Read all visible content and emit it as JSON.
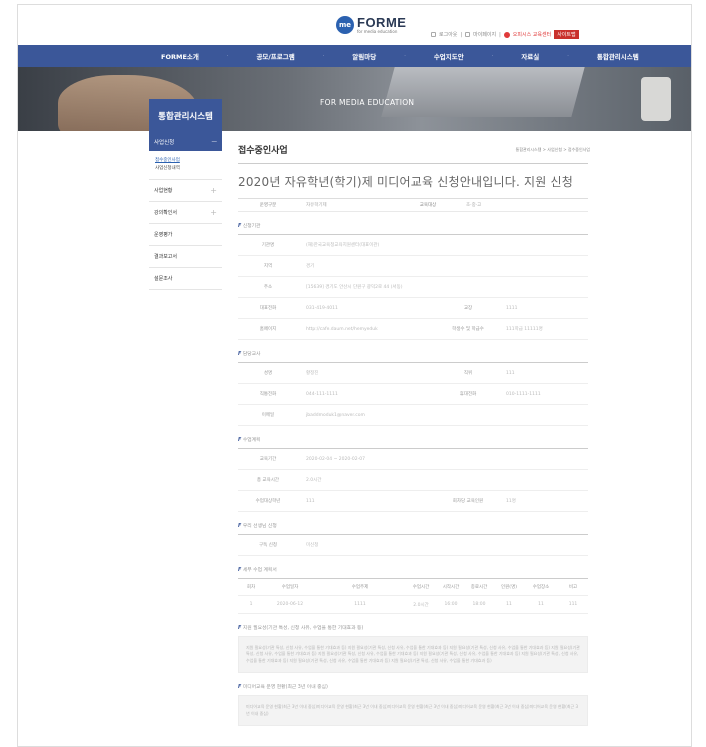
{
  "header": {
    "logo_mark": "me",
    "logo_title": "FORME",
    "logo_sub": "for media education",
    "util": [
      "로그아웃",
      "마이페이지",
      "오피시스 교육센터",
      "사이트맵"
    ],
    "util_badge": "사이트맵"
  },
  "nav": [
    "FORME소개",
    "공모/프로그램",
    "알림마당",
    "수업지도안",
    "자료실",
    "통합관리시스템"
  ],
  "banner": {
    "text": "FOR MEDIA EDUCATION"
  },
  "sidebar": {
    "title": "통합관리시스템",
    "active": "사업신청",
    "active_toggle": "—",
    "sub": [
      "접수중인사업",
      "사업신청내역"
    ],
    "items": [
      {
        "label": "사업현황",
        "plus": "+"
      },
      {
        "label": "강의확인서",
        "plus": "+"
      },
      {
        "label": "운영평가",
        "plus": ""
      },
      {
        "label": "결과보고서",
        "plus": ""
      },
      {
        "label": "설문조사",
        "plus": ""
      }
    ]
  },
  "content": {
    "page_title": "접수중인사업",
    "breadcrumb": "통합관리시스템 > 사업신청 > 접수중인사업",
    "headline": "2020년 자유학년(학기)제 미디어교육 신청안내입니다. 지원 신청",
    "summary": {
      "k1": "운영구분",
      "v1": "자유학기제",
      "k2": "교육대상",
      "v2": "초·중·고"
    },
    "sections": {
      "applicant": "신청기관",
      "manager": "담당교사",
      "plan": "수업계획",
      "request": "우리 선생님 신청",
      "schedule": "세부 수업 계획서",
      "reason": "지원 필요성(기관 특성, 신청 사유, 수업을 통한 기대효과 등)",
      "history": "미디어교육 운영 현황(최근 3년 이내 중심)"
    },
    "applicant": [
      {
        "k": "기관명",
        "v": "(재)한국교육청교육지원센터(대표이관)"
      },
      {
        "k": "지역",
        "v": "경기"
      },
      {
        "k": "주소",
        "v": "[15639] 경기도 안산시 단원구 광덕2로 44 (서동)"
      },
      {
        "k": "대표전화",
        "v": "031-419-4011",
        "k2": "교장",
        "v2": "1111"
      },
      {
        "k": "홈페이지",
        "v": "http://cafe.daum.net/hemyeduk",
        "k2": "학생수 및 학급수",
        "v2": "111학급 11111명"
      }
    ],
    "manager": [
      {
        "k": "성명",
        "v": "황정진",
        "k2": "직위",
        "v2": "111"
      },
      {
        "k": "직통전화",
        "v": "044-111-1111",
        "k2": "휴대전화",
        "v2": "010-1111-1111"
      },
      {
        "k": "이메일",
        "v": "jbaddmoduk1@naver.com"
      }
    ],
    "plan": [
      {
        "k": "교육기간",
        "v": "2020-02-04 ~ 2020-02-07"
      },
      {
        "k": "총 교육시간",
        "v": "2.0시간"
      },
      {
        "k": "수업대상학년",
        "v": "111",
        "k2": "회차당 교육인원",
        "v2": "11명"
      }
    ],
    "request": {
      "k": "구독 신청",
      "v": "미신청"
    },
    "schedule_head": [
      "회차",
      "수업일자",
      "수업주제",
      "수업시간",
      "시작시간",
      "종료시간",
      "인원(명)",
      "수업장소",
      "비고"
    ],
    "schedule_rows": [
      [
        "1",
        "2020-06-12",
        "1111",
        "2.0시간",
        "16:00",
        "18:00",
        "11",
        "11",
        "111"
      ]
    ],
    "reason_text": "지원 필요성(기관 특성, 신청 사유, 수업을 통한 기대효과 등) 지원 필요성(기관 특성, 신청 사유, 수업을 통한 기대효과 등) 지원 필요성(기관 특성, 신청 사유, 수업을 통한 기대효과 등) 지원 필요성(기관 특성, 신청 사유, 수업을 통한 기대효과 등) 지원 필요성(기관 특성, 신청 사유, 수업을 통한 기대효과 등) 지원 필요성(기관 특성, 신청 사유, 수업을 통한 기대효과 등) 지원 필요성(기관 특성, 신청 사유, 수업을 통한 기대효과 등) 지원 필요성(기관 특성, 신청 사유, 수업을 통한 기대효과 등) 지원 필요성(기관 특성, 신청 사유, 수업을 통한 기대효과 등)",
    "history_text": "미디어교육 운영 현황(최근 3년 이내 중심)미디어교육 운영 현황(최근 3년 이내 중심)미디어교육 운영 현황(최근 3년 이내 중심)미디어교육 운영 현황(최근 3년 이내 중심)미디어교육 운영 현황(최근 3년 이내 중심)"
  }
}
